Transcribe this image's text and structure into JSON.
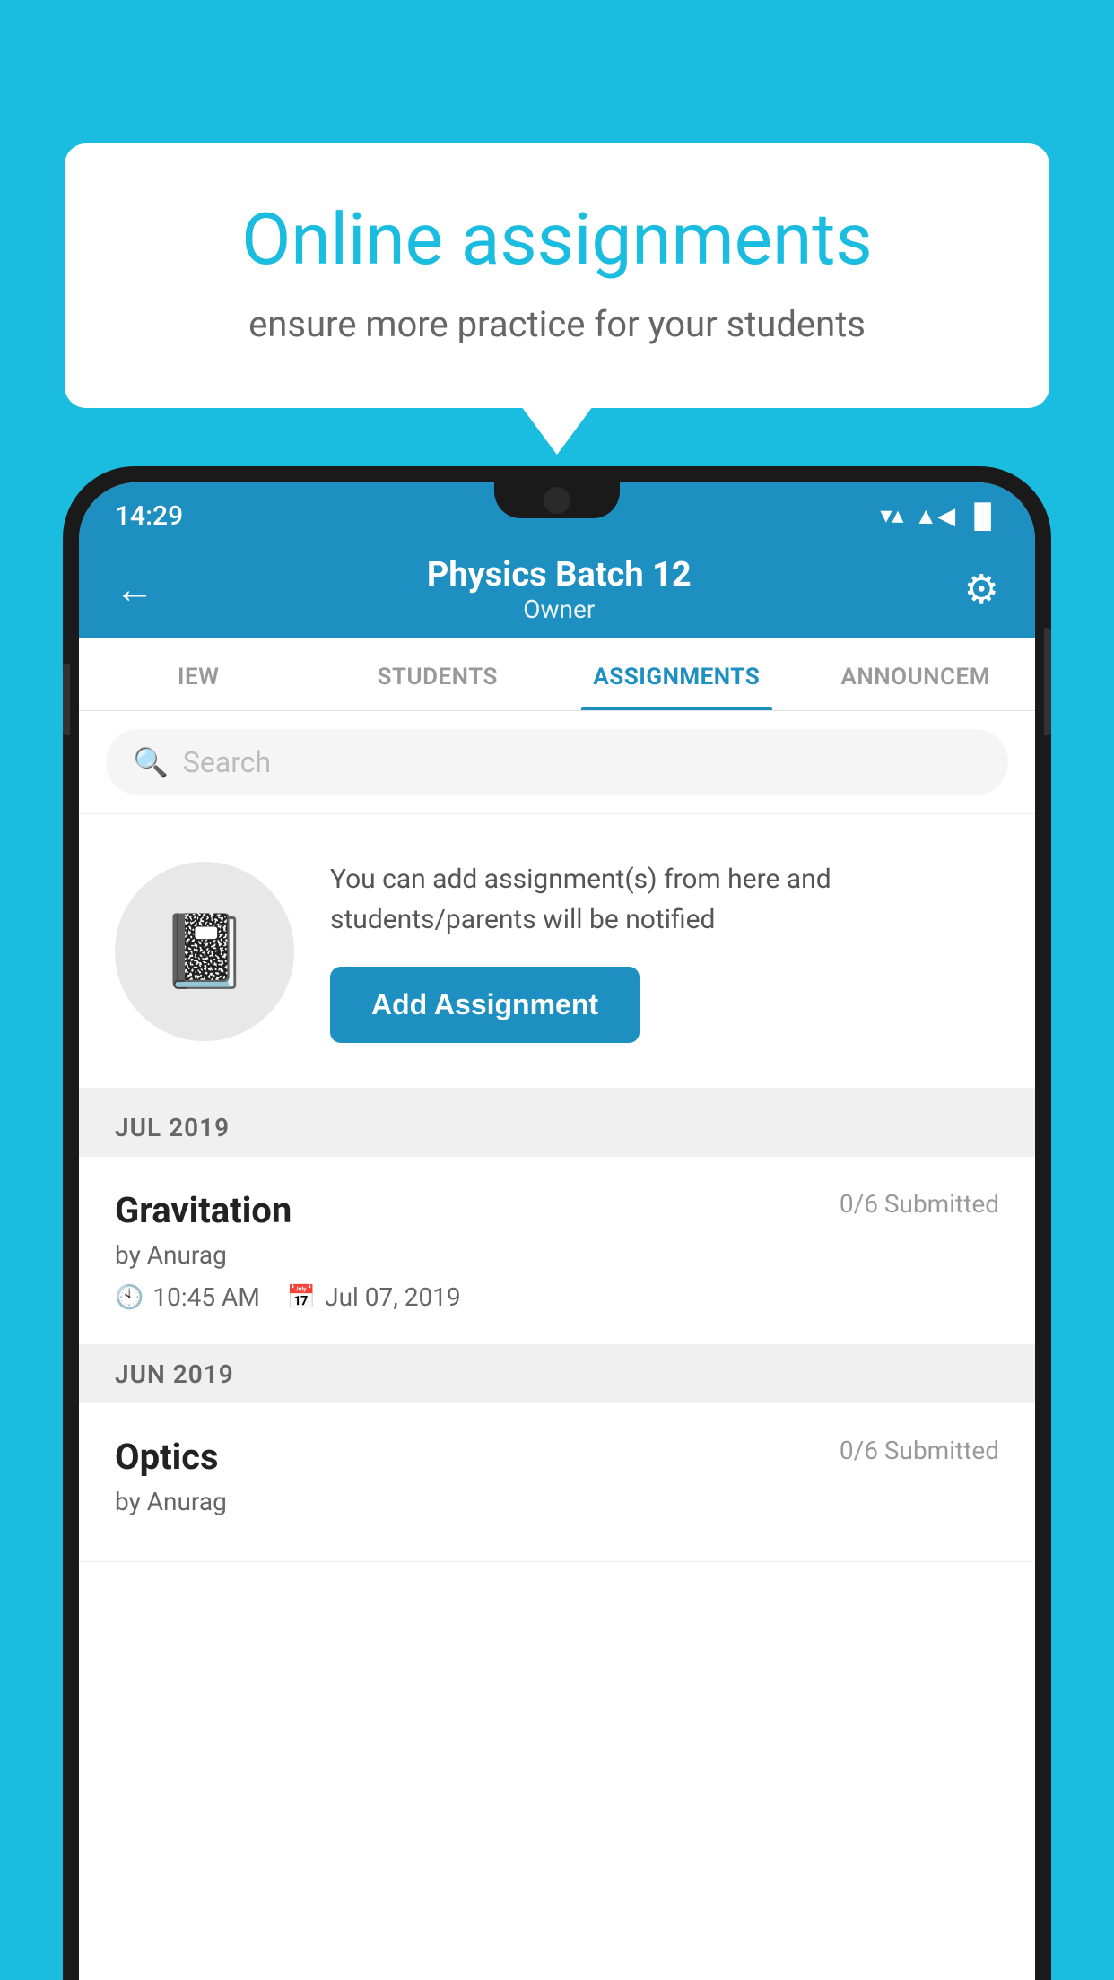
{
  "background": {
    "color": "#1ABCDF"
  },
  "speech_bubble": {
    "title": "Online assignments",
    "subtitle": "ensure more practice for your students"
  },
  "status_bar": {
    "time": "14:29",
    "wifi": "▼",
    "signal": "▲",
    "battery": "▐"
  },
  "header": {
    "title": "Physics Batch 12",
    "subtitle": "Owner",
    "back_label": "←",
    "settings_label": "⚙"
  },
  "tabs": [
    {
      "label": "IEW",
      "active": false
    },
    {
      "label": "STUDENTS",
      "active": false
    },
    {
      "label": "ASSIGNMENTS",
      "active": true
    },
    {
      "label": "ANNOUNCEM",
      "active": false
    }
  ],
  "search": {
    "placeholder": "Search"
  },
  "add_assignment_section": {
    "info_text": "You can add assignment(s) from here and students/parents will be notified",
    "button_label": "Add Assignment"
  },
  "sections": [
    {
      "header": "JUL 2019",
      "items": [
        {
          "name": "Gravitation",
          "submitted": "0/6 Submitted",
          "by": "by Anurag",
          "time": "10:45 AM",
          "date": "Jul 07, 2019"
        }
      ]
    },
    {
      "header": "JUN 2019",
      "items": [
        {
          "name": "Optics",
          "submitted": "0/6 Submitted",
          "by": "by Anurag",
          "time": "",
          "date": ""
        }
      ]
    }
  ]
}
